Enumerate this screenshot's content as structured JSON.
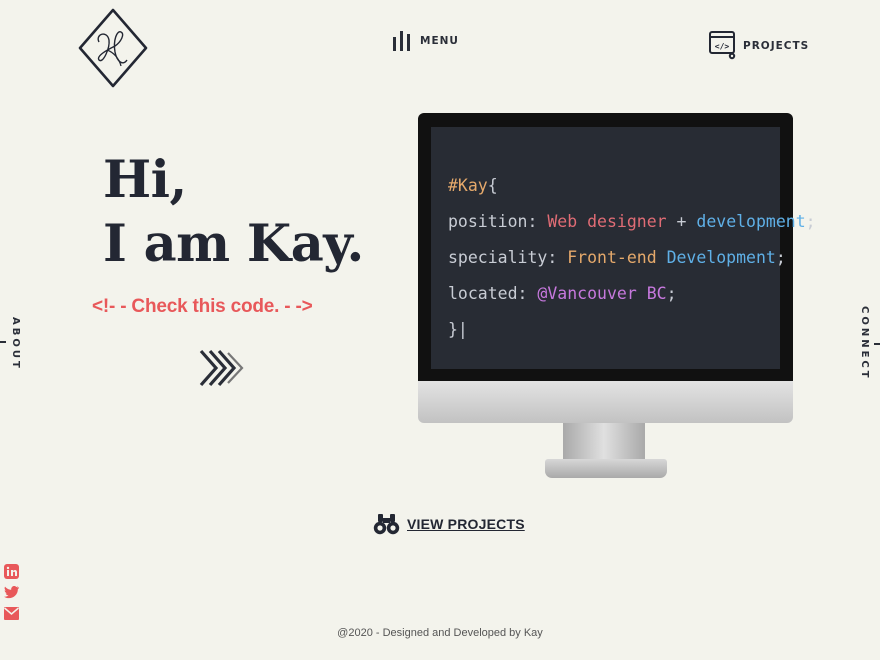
{
  "header": {
    "logo_icon": "signature-k-diamond-logo",
    "menu_label": "MENU",
    "menu_icon": "bars-icon",
    "projects_label": "PROJECTS",
    "projects_icon": "code-window-icon"
  },
  "hero": {
    "line1": "Hi,",
    "line2": "I am Kay.",
    "code_link": "<!- - Check this code. - ->",
    "arrows_icon": "chevrons-right-icon",
    "accent": "#e8585a"
  },
  "side": {
    "left": "ABOUT",
    "right": "CONNECT"
  },
  "code_block": {
    "selector": "#Kay",
    "open_brace": "{",
    "lines": [
      {
        "prop": "position",
        "parts": [
          {
            "text": "Web designer",
            "color": "#e06c75"
          },
          {
            "text": " + ",
            "color": "#c8ccd4"
          },
          {
            "text": "development",
            "color": "#5fb0e7"
          }
        ]
      },
      {
        "prop": "speciality",
        "parts": [
          {
            "text": "Front-end",
            "color": "#e5a96b"
          },
          {
            "text": " ",
            "color": "#c8ccd4"
          },
          {
            "text": "Development",
            "color": "#5fb0e7"
          }
        ]
      },
      {
        "prop": "located",
        "parts": [
          {
            "text": "@Vancouver BC",
            "color": "#c678dd"
          }
        ]
      }
    ],
    "close": "}|",
    "background": "#282c34"
  },
  "view_projects": {
    "label": "VIEW PROJECTS",
    "icon": "binoculars-icon"
  },
  "social": [
    {
      "name": "linkedin-icon",
      "glyph": "in"
    },
    {
      "name": "twitter-icon",
      "glyph": "t"
    },
    {
      "name": "mail-icon",
      "glyph": "✉"
    }
  ],
  "social_color": "#e8585a",
  "footer": "@2020 - Designed and Developed by Kay"
}
